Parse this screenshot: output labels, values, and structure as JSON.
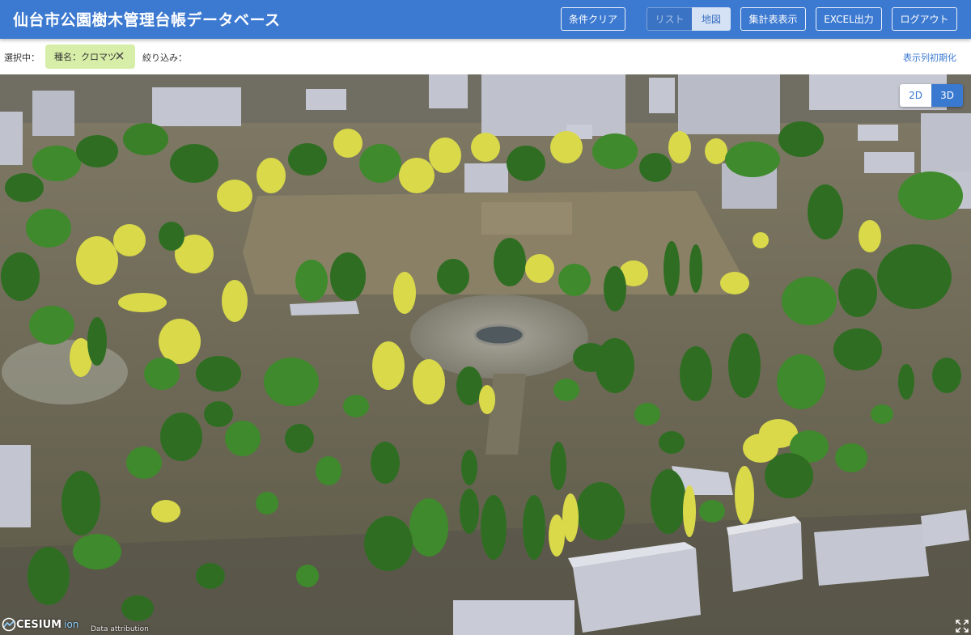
{
  "app": {
    "title": "仙台市公園樹木管理台帳データベース"
  },
  "header": {
    "clear_button": "条件クリア",
    "view_list": "リスト",
    "view_map": "地図",
    "summary_button": "集計表表示",
    "excel_button": "EXCEL出力",
    "logout_button": "ログアウト",
    "selected_view": "地図"
  },
  "filters": {
    "selected_label": "選択中：",
    "chip_label": "種名：クロマツ",
    "narrow_label": "絞り込み：",
    "reset_columns": "表示列初期化"
  },
  "map": {
    "toggle_2d": "2D",
    "toggle_3d": "3D",
    "active_mode": "3D",
    "logo_text": "CESIUM",
    "logo_sub": "ion",
    "attribution": "Data attribution"
  },
  "colors": {
    "header": "#3c79d0",
    "chip": "#d7eea8",
    "tree_dark": "#2f6e22",
    "tree_mid": "#3f8a2c",
    "tree_highlight": "#d9d94a",
    "field": "#8a7f63",
    "building": "#c9ccd6"
  }
}
